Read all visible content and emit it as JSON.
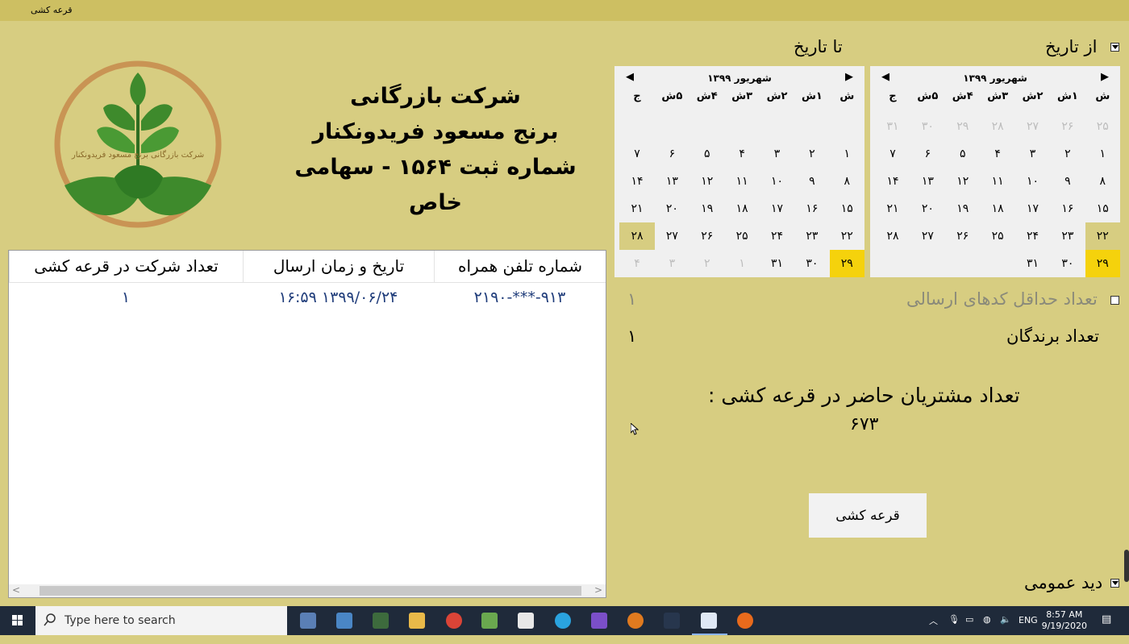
{
  "window": {
    "title": "قرعه کشی"
  },
  "filters": {
    "from_date_label": "از تاریخ",
    "to_date_label": "تا تاریخ",
    "min_codes_label": "تعداد حداقل کدهای ارسالی",
    "min_codes_value": "۱",
    "winners_label": "تعداد برندگان",
    "winners_value": "۱"
  },
  "calendar_from": {
    "title": "شهریور ۱۳۹۹",
    "dows": [
      "ش",
      "۱ش",
      "۲ش",
      "۳ش",
      "۴ش",
      "۵ش",
      "ج"
    ],
    "weeks": [
      [
        "۲۵",
        "۲۶",
        "۲۷",
        "۲۸",
        "۲۹",
        "۳۰",
        "۳۱"
      ],
      [
        "۱",
        "۲",
        "۳",
        "۴",
        "۵",
        "۶",
        "۷"
      ],
      [
        "۸",
        "۹",
        "۱۰",
        "۱۱",
        "۱۲",
        "۱۳",
        "۱۴"
      ],
      [
        "۱۵",
        "۱۶",
        "۱۷",
        "۱۸",
        "۱۹",
        "۲۰",
        "۲۱"
      ],
      [
        "۲۲",
        "۲۳",
        "۲۴",
        "۲۵",
        "۲۶",
        "۲۷",
        "۲۸"
      ],
      [
        "۲۹",
        "۳۰",
        "۳۱",
        "",
        "",
        "",
        ""
      ]
    ]
  },
  "calendar_to": {
    "title": "شهریور ۱۳۹۹",
    "dows": [
      "ش",
      "۱ش",
      "۲ش",
      "۳ش",
      "۴ش",
      "۵ش",
      "ج"
    ],
    "weeks": [
      [
        "",
        "",
        "",
        "",
        "",
        "",
        ""
      ],
      [
        "۱",
        "۲",
        "۳",
        "۴",
        "۵",
        "۶",
        "۷"
      ],
      [
        "۸",
        "۹",
        "۱۰",
        "۱۱",
        "۱۲",
        "۱۳",
        "۱۴"
      ],
      [
        "۱۵",
        "۱۶",
        "۱۷",
        "۱۸",
        "۱۹",
        "۲۰",
        "۲۱"
      ],
      [
        "۲۲",
        "۲۳",
        "۲۴",
        "۲۵",
        "۲۶",
        "۲۷",
        "۲۸"
      ],
      [
        "۲۹",
        "۳۰",
        "۳۱",
        "۱",
        "۲",
        "۳",
        "۴"
      ]
    ]
  },
  "company": {
    "line1": "شرکت بازرگانی",
    "line2": "برنج مسعود فریدونکنار",
    "line3": "شماره ثبت ۱۵۶۴ - سهامی خاص"
  },
  "table": {
    "columns": [
      "شماره تلفن همراه",
      "تاریخ و زمان ارسال",
      "تعداد شرکت در قرعه کشی"
    ],
    "rows": [
      [
        "۹۱۳-***-۲۱۹۰",
        "۱۳۹۹/۰۶/۲۴ ۱۶:۵۹",
        "۱"
      ]
    ]
  },
  "summary": {
    "customers_label": "تعداد مشتریان حاضر در قرعه کشی :",
    "customers_value": "۶۷۳"
  },
  "actions": {
    "draw_button": "قرعه کشی"
  },
  "footer": {
    "overview_label": "دید عمومی"
  },
  "taskbar": {
    "search_placeholder": "Type here to search",
    "lang": "ENG",
    "time": "8:57 AM",
    "date": "9/19/2020"
  },
  "colors": {
    "background": "#d7cd81",
    "selected_day": "#f5d20c",
    "taskbar": "#1f2a3a"
  }
}
